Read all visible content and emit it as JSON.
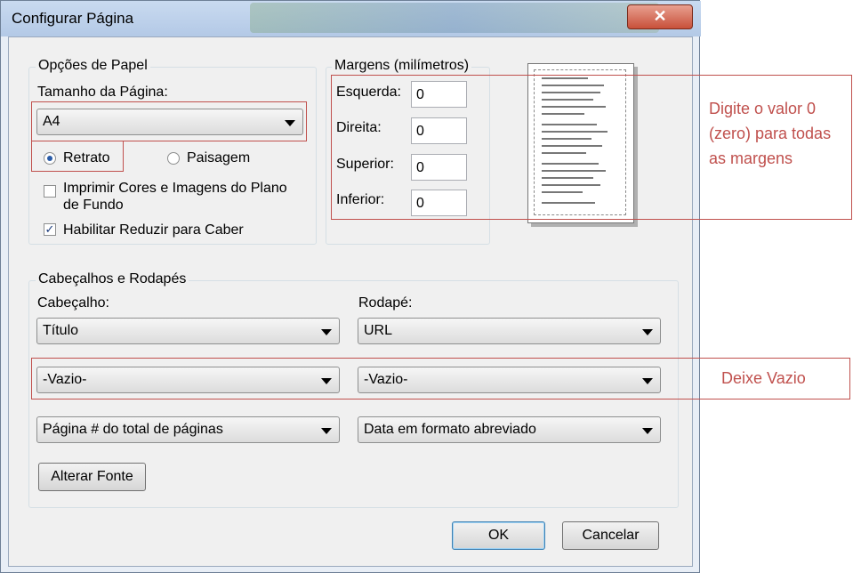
{
  "window": {
    "title": "Configurar Página",
    "close_label": "✕"
  },
  "paper_options": {
    "legend": "Opções de Papel",
    "page_size_label": "Tamanho da Página:",
    "page_size_value": "A4",
    "orientation_portrait": "Retrato",
    "orientation_landscape": "Paisagem",
    "orientation_selected": "Retrato",
    "print_background_label": "Imprimir Cores e Imagens do Plano de Fundo",
    "print_background_checked": false,
    "shrink_to_fit_label": "Habilitar Reduzir para Caber",
    "shrink_to_fit_checked": true
  },
  "margins": {
    "legend": "Margens (milímetros)",
    "left_label": "Esquerda:",
    "left_value": "0",
    "right_label": "Direita:",
    "right_value": "0",
    "top_label": "Superior:",
    "top_value": "0",
    "bottom_label": "Inferior:",
    "bottom_value": "0"
  },
  "headers_footers": {
    "legend": "Cabeçalhos e Rodapés",
    "header_label": "Cabeçalho:",
    "footer_label": "Rodapé:",
    "header_1": "Título",
    "header_2": "-Vazio-",
    "header_3": "Página # do total de páginas",
    "footer_1": "URL",
    "footer_2": "-Vazio-",
    "footer_3": "Data em formato abreviado",
    "change_font_label": "Alterar Fonte"
  },
  "buttons": {
    "ok": "OK",
    "cancel": "Cancelar"
  },
  "annotations": {
    "margins_note": "Digite o valor 0 (zero) para todas as margens",
    "empty_note": "Deixe Vazio",
    "color": "#c0504d"
  }
}
